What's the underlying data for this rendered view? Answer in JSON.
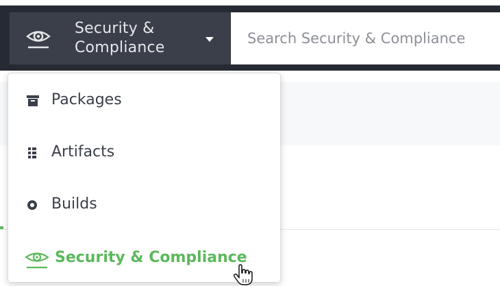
{
  "header": {
    "switcher": {
      "label": "Security &\nCompliance",
      "icon": "eye-icon",
      "caret_icon": "caret-down-icon"
    },
    "search": {
      "placeholder": "Search Security & Compliance",
      "value": ""
    }
  },
  "menu": {
    "items": [
      {
        "label": "Packages",
        "icon": "packages-icon",
        "active": false
      },
      {
        "label": "Artifacts",
        "icon": "artifacts-icon",
        "active": false
      },
      {
        "label": "Builds",
        "icon": "builds-icon",
        "active": false
      },
      {
        "label": "Security & Compliance",
        "icon": "eye-icon",
        "active": true
      }
    ]
  },
  "colors": {
    "header_bg": "#262a33",
    "switcher_bg": "#3b3f4a",
    "active_green": "#5cb85c",
    "menu_text": "#3b3f4a"
  },
  "pointer": "hand-cursor-icon"
}
